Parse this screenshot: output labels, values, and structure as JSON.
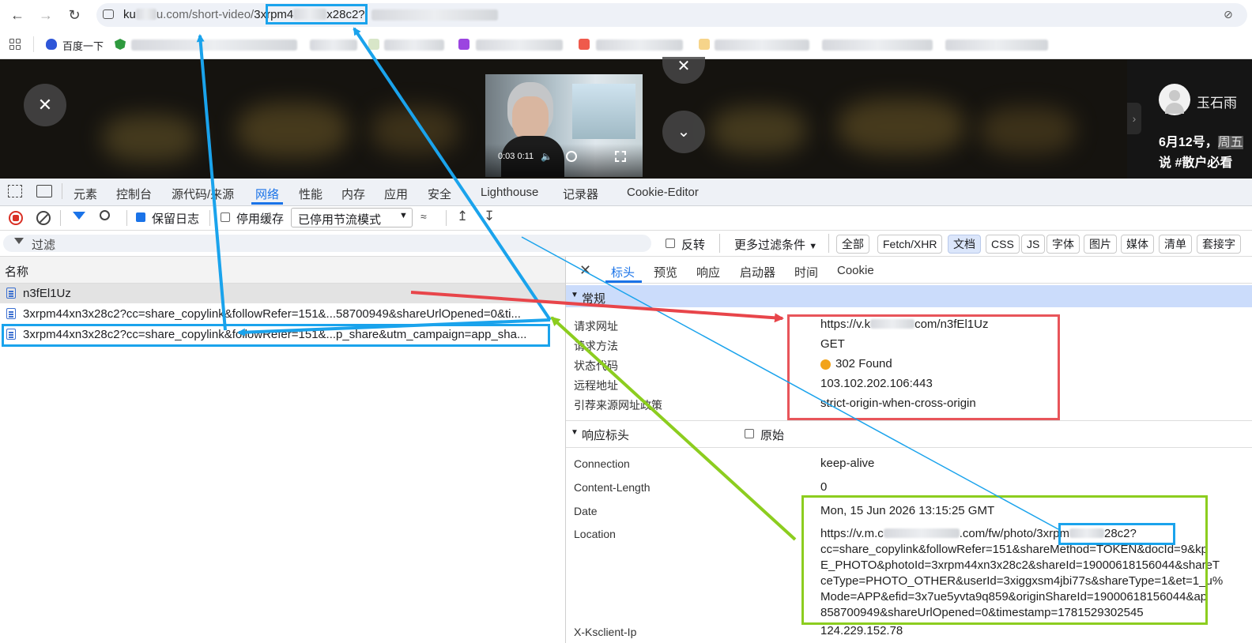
{
  "browser": {
    "url_prefix": "ku",
    "url_domain_tail": "u.com/short-video/",
    "url_id_start": "3xrpm4",
    "url_id_end": "x28c2?",
    "bookmark_label": "百度一下"
  },
  "video": {
    "time_display": "0:03 0:11"
  },
  "sidebar_right": {
    "author": "玉石雨",
    "caption_line1": "6月12号，",
    "caption_line1_extra": "周五",
    "caption_line2": "说 #散户必看"
  },
  "devtools": {
    "tabs": [
      "元素",
      "控制台",
      "源代码/来源",
      "网络",
      "性能",
      "内存",
      "应用",
      "安全",
      "Lighthouse",
      "记录器",
      "Cookie-Editor"
    ],
    "active_tab": "网络",
    "toolbar": {
      "preserve_log": "保留日志",
      "disable_cache": "停用缓存",
      "throttle": "已停用节流模式"
    },
    "filter": {
      "placeholder": "过滤",
      "invert": "反转",
      "more_filters": "更多过滤条件",
      "chips": [
        "全部",
        "Fetch/XHR",
        "文档",
        "CSS",
        "JS",
        "字体",
        "图片",
        "媒体",
        "清单",
        "套接字"
      ],
      "active_chip": "文档"
    },
    "list_header": "名称",
    "requests": [
      "n3fEl1Uz",
      "3xrpm44xn3x28c2?cc=share_copylink&followRefer=151&...58700949&shareUrlOpened=0&ti...",
      "3xrpm44xn3x28c2?cc=share_copylink&followRefer=151&...p_share&utm_campaign=app_sha..."
    ],
    "detail_tabs": [
      "标头",
      "预览",
      "响应",
      "启动器",
      "时间",
      "Cookie"
    ],
    "active_detail_tab": "标头",
    "general": {
      "title": "常规",
      "rows": [
        {
          "key": "请求网址",
          "val": "https://v.k",
          "val_tail": "com/n3fEl1Uz"
        },
        {
          "key": "请求方法",
          "val": "GET"
        },
        {
          "key": "状态代码",
          "val": "302 Found"
        },
        {
          "key": "远程地址",
          "val": "103.102.202.106:443"
        },
        {
          "key": "引荐来源网址政策",
          "val": "strict-origin-when-cross-origin"
        }
      ]
    },
    "response_headers": {
      "title": "响应标头",
      "raw_label": "原始",
      "rows": [
        {
          "key": "Connection",
          "val": "keep-alive"
        },
        {
          "key": "Content-Length",
          "val": "0"
        },
        {
          "key": "Date",
          "val": "Mon, 15 Jun 2026 13:15:25 GMT"
        },
        {
          "key": "Location",
          "val": ""
        },
        {
          "key": "X-Ksclient-Ip",
          "val": "124.229.152.78"
        }
      ],
      "location_lines": [
        "https://v.m.c",
        ".com/fw/photo/",
        "3xrpm",
        "28c2?",
        "cc=share_copylink&followRefer=151&shareMethod=TOKEN&docId=9&kp",
        "E_PHOTO&photoId=3xrpm44xn3x28c2&shareId=19000618156044&shareT",
        "ceType=PHOTO_OTHER&userId=3xiggxsm4jbi77s&shareType=1&et=1_u%",
        "Mode=APP&efid=3x7ue5yvta9q859&originShareId=19000618156044&ap",
        "858700949&shareUrlOpened=0&timestamp=1781529302545"
      ]
    }
  },
  "colors": {
    "accent": "#1a73e8",
    "annotation_blue": "#1aa3ec",
    "annotation_red": "#e8555a",
    "annotation_green": "#8ccd1f",
    "status_dot": "#f2a31a"
  }
}
